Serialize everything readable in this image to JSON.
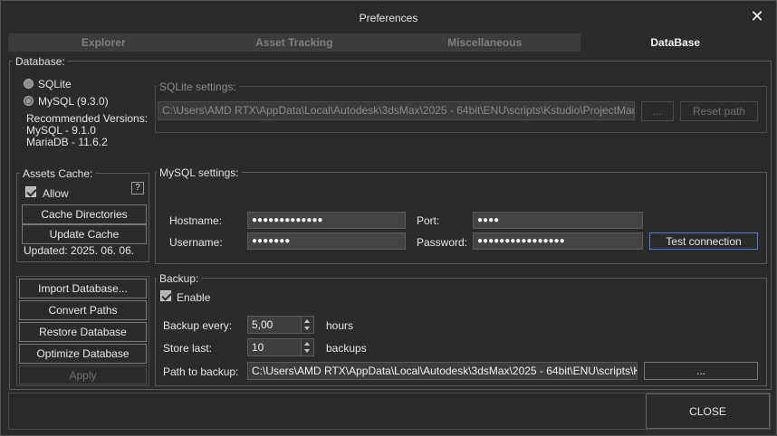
{
  "window": {
    "title": "Preferences",
    "close_glyph": "✕"
  },
  "tabs": [
    {
      "label": "Explorer",
      "active": false
    },
    {
      "label": "Asset Tracking",
      "active": false
    },
    {
      "label": "Miscellaneous",
      "active": false
    },
    {
      "label": "DataBase",
      "active": true
    }
  ],
  "database": {
    "group_label": "Database:",
    "radio_sqlite": "SQLite",
    "radio_mysql": "MySQL (9.3.0)",
    "recommended_title": "Recommended Versions:",
    "recommended_mysql": "MySQL - 9.1.0",
    "recommended_mariadb": "MariaDB - 11.6.2"
  },
  "sqlite": {
    "group_label": "SQLite settings:",
    "path_value": "C:\\Users\\AMD RTX\\AppData\\Local\\Autodesk\\3dsMax\\2025 - 64bit\\ENU\\scripts\\Kstudio\\ProjectManager",
    "browse_label": "...",
    "reset_label": "Reset path"
  },
  "assets_cache": {
    "group_label": "Assets Cache:",
    "allow_label": "Allow",
    "help_label": "?",
    "cache_dirs_label": "Cache Directories",
    "update_cache_label": "Update Cache",
    "updated_text": "Updated: 2025. 06. 06."
  },
  "mysql": {
    "group_label": "MySQL settings:",
    "hostname_label": "Hostname:",
    "hostname_value": "●●●●●●●●●●●●●",
    "username_label": "Username:",
    "username_value": "●●●●●●●",
    "port_label": "Port:",
    "port_value": "●●●●",
    "password_label": "Password:",
    "password_value": "●●●●●●●●●●●●●●●●",
    "test_label": "Test connection"
  },
  "actions": {
    "import_label": "Import Database...",
    "convert_label": "Convert Paths",
    "restore_label": "Restore Database",
    "optimize_label": "Optimize Database",
    "apply_label": "Apply"
  },
  "backup": {
    "group_label": "Backup:",
    "enable_label": "Enable",
    "every_label": "Backup every:",
    "every_value": "5,00",
    "every_unit": "hours",
    "store_label": "Store last:",
    "store_value": "10",
    "store_unit": "backups",
    "path_label": "Path to backup:",
    "path_value": "C:\\Users\\AMD RTX\\AppData\\Local\\Autodesk\\3dsMax\\2025 - 64bit\\ENU\\scripts\\Kstudio\\",
    "browse_label": "..."
  },
  "footer": {
    "close_label": "CLOSE"
  }
}
